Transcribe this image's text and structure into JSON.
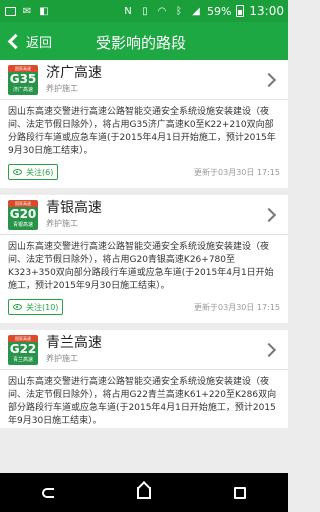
{
  "status_bar": {
    "battery": "59%",
    "time": "13:00"
  },
  "header": {
    "back_label": "返回",
    "title": "受影响的路段"
  },
  "roads": [
    {
      "badge_top": "国家高速",
      "code": "G35",
      "badge_name": "济广高速",
      "name": "济广高速",
      "type": "养护施工",
      "description": "因山东高速交警进行高速公路智能交通安全系统设施安装建设（夜间、法定节假日除外），将占用G35济广高速K0至K22+210双向部分路段行车道或应急车道(于2015年4月1日开始施工，预计2015年9月30日施工结束）。",
      "follow": "关注(6)",
      "updated": "更新于03月30日 17:15"
    },
    {
      "badge_top": "国家高速",
      "code": "G20",
      "badge_name": "青银高速",
      "name": "青银高速",
      "type": "养护施工",
      "description": "因山东高速交警进行高速公路智能交通安全系统设施安装建设（夜间、法定节假日除外），将占用G20青银高速K26+780至K323+350双向部分路段行车道或应急车道(于2015年4月1日开始施工，预计2015年9月30日施工结束）。",
      "follow": "关注(10)",
      "updated": "更新于03月30日 17:15"
    },
    {
      "badge_top": "国家高速",
      "code": "G22",
      "badge_name": "青兰高速",
      "name": "青兰高速",
      "type": "养护施工",
      "description": "因山东高速交警进行高速公路智能交通安全系统设施安装建设（夜间、法定节假日除外），将占用G22青兰高速K61+220至K286双向部分路段行车道或应急车道(于2015年4月1日开始施工，预计2015年9月30日施工结束）。"
    }
  ]
}
